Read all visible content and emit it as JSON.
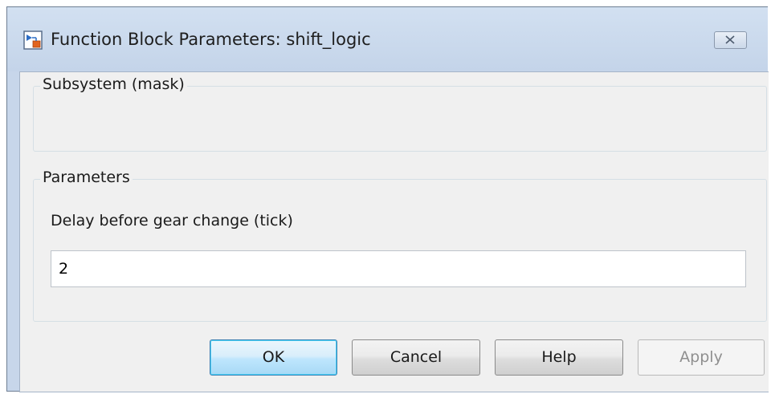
{
  "window": {
    "title": "Function Block Parameters: shift_logic",
    "icon": "simulink-block-icon",
    "close_icon": "close-icon"
  },
  "subsystem_group": {
    "label": "Subsystem (mask)"
  },
  "parameters_group": {
    "label": "Parameters",
    "delay_field": {
      "label": "Delay before gear change (tick)",
      "value": "2"
    }
  },
  "buttons": {
    "ok": "OK",
    "cancel": "Cancel",
    "help": "Help",
    "apply": "Apply"
  },
  "colors": {
    "title_bar": "#c7d6ea",
    "client_background": "#f0f0f0",
    "default_button_border": "#3c7fb1"
  }
}
